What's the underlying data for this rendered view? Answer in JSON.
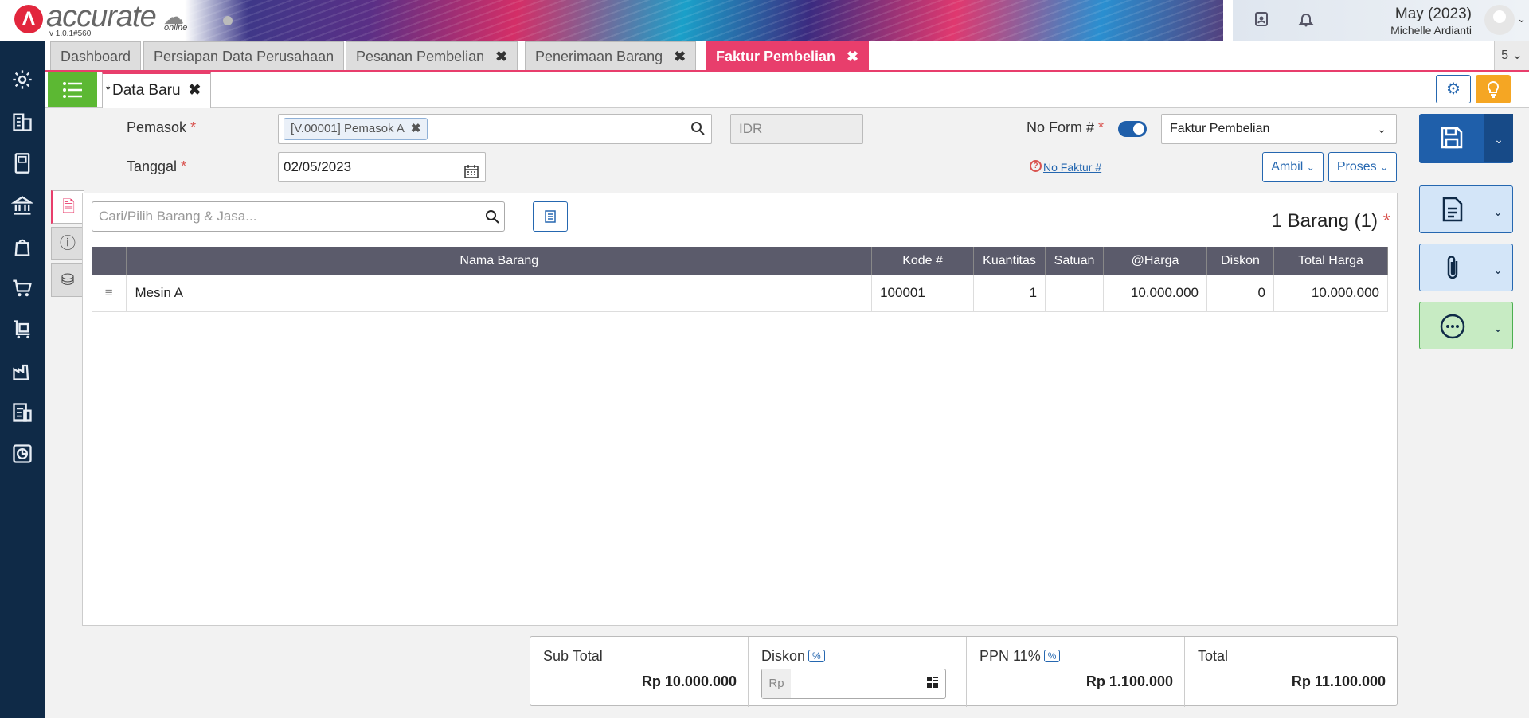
{
  "header": {
    "brand": "accurate",
    "brand_sub": "online",
    "version": "v 1.0.1#560",
    "period": "May (2023)",
    "user_name": "Michelle Ardianti"
  },
  "tabs": [
    {
      "label": "Dashboard",
      "closable": false
    },
    {
      "label": "Persiapan Data Perusahaan",
      "closable": false
    },
    {
      "label": "Pesanan Pembelian",
      "closable": true
    },
    {
      "label": "Penerimaan Barang",
      "closable": true
    },
    {
      "label": "Faktur Pembelian",
      "closable": true,
      "active": true
    }
  ],
  "tab_count": "5",
  "subtab": {
    "label": "Data Baru",
    "modified_mark": "*"
  },
  "form": {
    "supplier_label": "Pemasok",
    "supplier_value": "[V.00001] Pemasok A",
    "currency": "IDR",
    "date_label": "Tanggal",
    "date_value": "02/05/2023",
    "form_no_label": "No Form #",
    "form_type": "Faktur Pembelian",
    "invoice_no_link": "No Faktur #",
    "ambil_label": "Ambil",
    "proses_label": "Proses",
    "required_mark": "*"
  },
  "items": {
    "search_placeholder": "Cari/Pilih Barang & Jasa...",
    "count_text": "1 Barang (1)",
    "columns": [
      "Nama Barang",
      "Kode #",
      "Kuantitas",
      "Satuan",
      "@Harga",
      "Diskon",
      "Total Harga"
    ],
    "rows": [
      {
        "name": "Mesin A",
        "code": "100001",
        "qty": "1",
        "unit": "",
        "price": "10.000.000",
        "discount": "0",
        "total": "10.000.000"
      }
    ]
  },
  "totals": {
    "subtotal_label": "Sub Total",
    "subtotal_value": "Rp 10.000.000",
    "discount_label": "Diskon",
    "pct": "%",
    "rp_prefix": "Rp",
    "ppn_label": "PPN 11%",
    "ppn_value": "Rp 1.100.000",
    "total_label": "Total",
    "total_value": "Rp 11.100.000"
  },
  "colors": {
    "accent_pink": "#e83e6c",
    "sidebar_navy": "#0f2a47",
    "primary_blue": "#1f5faa",
    "green": "#5cb833",
    "orange": "#f5a623"
  }
}
